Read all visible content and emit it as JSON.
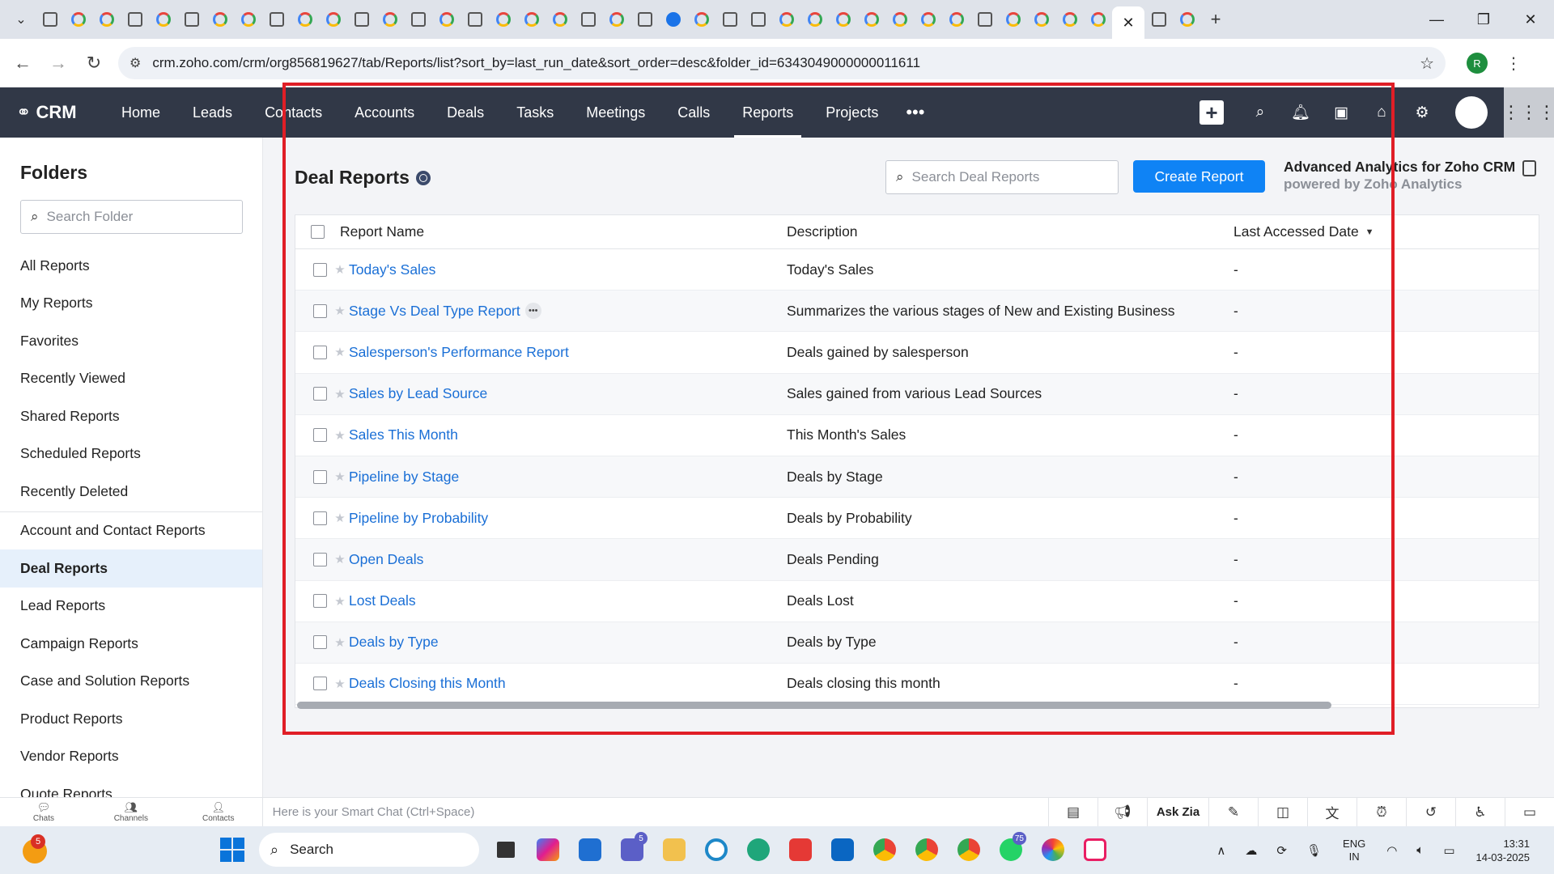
{
  "browser": {
    "url": "crm.zoho.com/crm/org856819627/tab/Reports/list?sort_by=last_run_date&sort_order=desc&folder_id=6343049000000011611",
    "profile_initial": "R",
    "tab_count": 45
  },
  "crm": {
    "brand": "CRM",
    "nav": [
      "Home",
      "Leads",
      "Contacts",
      "Accounts",
      "Deals",
      "Tasks",
      "Meetings",
      "Calls",
      "Reports",
      "Projects"
    ],
    "active_nav": "Reports",
    "more": "•••"
  },
  "sidebar": {
    "title": "Folders",
    "search_placeholder": "Search Folder",
    "items": [
      {
        "label": "All Reports"
      },
      {
        "label": "My Reports"
      },
      {
        "label": "Favorites"
      },
      {
        "label": "Recently Viewed"
      },
      {
        "label": "Shared Reports"
      },
      {
        "label": "Scheduled Reports"
      },
      {
        "label": "Recently Deleted"
      },
      {
        "label": "Account and Contact Reports"
      },
      {
        "label": "Deal Reports",
        "active": true
      },
      {
        "label": "Lead Reports"
      },
      {
        "label": "Campaign Reports"
      },
      {
        "label": "Case and Solution Reports"
      },
      {
        "label": "Product Reports"
      },
      {
        "label": "Vendor Reports"
      },
      {
        "label": "Quote Reports"
      }
    ]
  },
  "main": {
    "title": "Deal Reports",
    "search_placeholder": "Search Deal Reports",
    "create_button": "Create Report",
    "analytics_title": "Advanced Analytics for Zoho CRM",
    "analytics_sub": "powered by Zoho Analytics",
    "columns": [
      "Report Name",
      "Description",
      "Last Accessed Date"
    ],
    "rows": [
      {
        "name": "Today's Sales",
        "desc": "Today's Sales",
        "date": "-"
      },
      {
        "name": "Stage Vs Deal Type Report",
        "desc": "Summarizes the various stages of New and Existing Business",
        "date": "-"
      },
      {
        "name": "Salesperson's Performance Report",
        "desc": "Deals gained by salesperson",
        "date": "-"
      },
      {
        "name": "Sales by Lead Source",
        "desc": "Sales gained from various Lead Sources",
        "date": "-"
      },
      {
        "name": "Sales This Month",
        "desc": "This Month's Sales",
        "date": "-"
      },
      {
        "name": "Pipeline by Stage",
        "desc": "Deals by Stage",
        "date": "-"
      },
      {
        "name": "Pipeline by Probability",
        "desc": "Deals by Probability",
        "date": "-"
      },
      {
        "name": "Open Deals",
        "desc": "Deals Pending",
        "date": "-"
      },
      {
        "name": "Lost Deals",
        "desc": "Deals Lost",
        "date": "-"
      },
      {
        "name": "Deals by Type",
        "desc": "Deals by Type",
        "date": "-"
      },
      {
        "name": "Deals Closing this Month",
        "desc": "Deals closing this month",
        "date": "-"
      }
    ]
  },
  "chatbar": {
    "tabs": [
      "Chats",
      "Channels",
      "Contacts"
    ],
    "placeholder": "Here is your Smart Chat (Ctrl+Space)",
    "ask_zia": "Ask Zia"
  },
  "taskbar": {
    "search": "Search",
    "weather_badge": "5",
    "teams_badge": "5",
    "whatsapp_badge": "75",
    "lang_line1": "ENG",
    "lang_line2": "IN",
    "time": "13:31",
    "date": "14-03-2025"
  },
  "colors": {
    "crm_nav_bg": "#313847",
    "link": "#1a6fd6",
    "primary_button": "#0f83f5",
    "active_folder_bg": "#e6f0fb",
    "highlight_frame": "#e01e26"
  }
}
